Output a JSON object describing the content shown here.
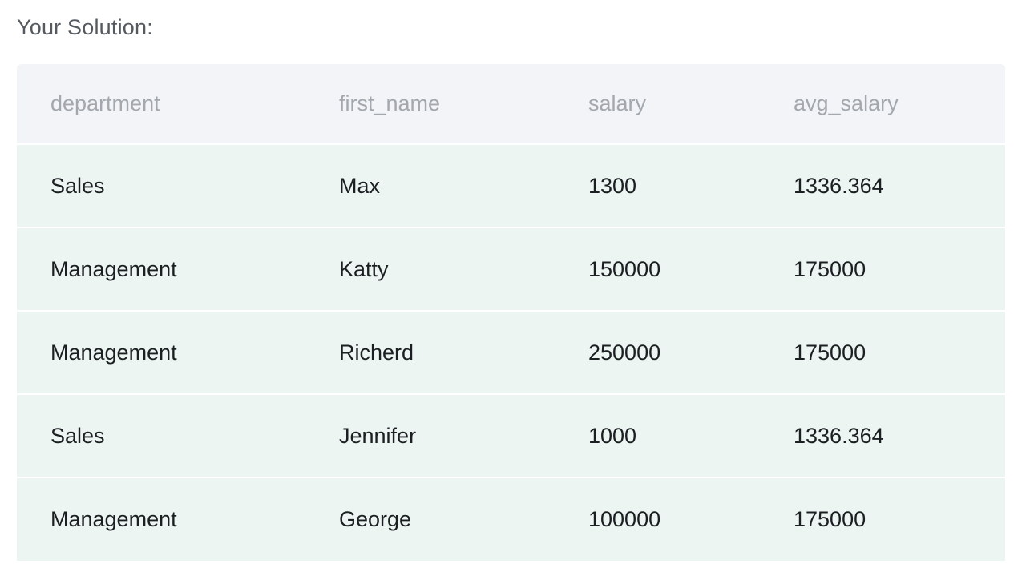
{
  "heading": "Your Solution:",
  "table": {
    "columns": [
      "department",
      "first_name",
      "salary",
      "avg_salary"
    ],
    "rows": [
      [
        "Sales",
        "Max",
        "1300",
        "1336.364"
      ],
      [
        "Management",
        "Katty",
        "150000",
        "175000"
      ],
      [
        "Management",
        "Richerd",
        "250000",
        "175000"
      ],
      [
        "Sales",
        "Jennifer",
        "1000",
        "1336.364"
      ],
      [
        "Management",
        "George",
        "100000",
        "175000"
      ]
    ]
  },
  "colors": {
    "header_bg": "#f3f4f7",
    "row_bg": "#edf5f3",
    "header_text": "#a3a8ae",
    "cell_text": "#1c1f22",
    "heading_text": "#555a60"
  }
}
